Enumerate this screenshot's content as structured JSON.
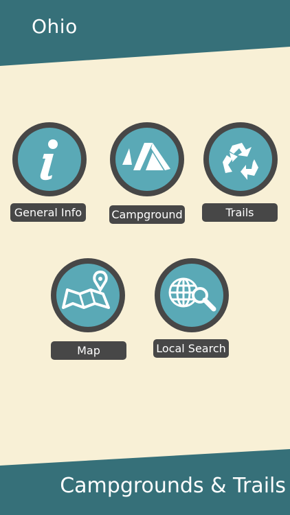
{
  "header": {
    "title": "Ohio"
  },
  "footer": {
    "title": "Campgrounds & Trails"
  },
  "menu": {
    "general_info": {
      "label": "General Info",
      "icon": "info-icon"
    },
    "campground": {
      "label": "Campground",
      "icon": "tent-icon"
    },
    "trails": {
      "label": "Trails",
      "icon": "recycle-icon"
    },
    "map": {
      "label": "Map",
      "icon": "map-pin-icon"
    },
    "local_search": {
      "label": "Local Search",
      "icon": "globe-search-icon"
    }
  },
  "colors": {
    "band": "#367079",
    "background": "#f8f0d6",
    "icon_fill": "#5aa9b6",
    "ring": "#474747",
    "label_bg": "#474747"
  }
}
